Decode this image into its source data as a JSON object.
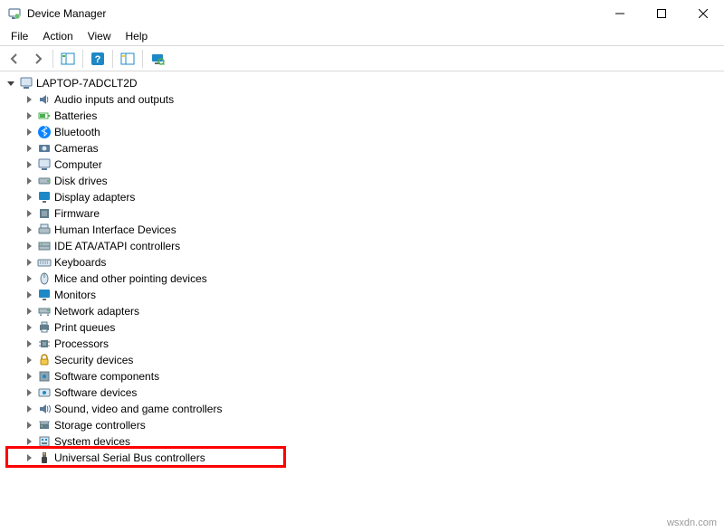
{
  "window": {
    "title": "Device Manager"
  },
  "menu": {
    "items": [
      "File",
      "Action",
      "View",
      "Help"
    ]
  },
  "tree": {
    "root": {
      "label": "LAPTOP-7ADCLT2D",
      "expanded": true
    },
    "children": [
      {
        "label": "Audio inputs and outputs",
        "icon": "audio"
      },
      {
        "label": "Batteries",
        "icon": "battery"
      },
      {
        "label": "Bluetooth",
        "icon": "bluetooth"
      },
      {
        "label": "Cameras",
        "icon": "camera"
      },
      {
        "label": "Computer",
        "icon": "computer"
      },
      {
        "label": "Disk drives",
        "icon": "disk"
      },
      {
        "label": "Display adapters",
        "icon": "display"
      },
      {
        "label": "Firmware",
        "icon": "firmware"
      },
      {
        "label": "Human Interface Devices",
        "icon": "hid"
      },
      {
        "label": "IDE ATA/ATAPI controllers",
        "icon": "ide"
      },
      {
        "label": "Keyboards",
        "icon": "keyboard"
      },
      {
        "label": "Mice and other pointing devices",
        "icon": "mouse"
      },
      {
        "label": "Monitors",
        "icon": "monitor"
      },
      {
        "label": "Network adapters",
        "icon": "network"
      },
      {
        "label": "Print queues",
        "icon": "printer"
      },
      {
        "label": "Processors",
        "icon": "cpu"
      },
      {
        "label": "Security devices",
        "icon": "security"
      },
      {
        "label": "Software components",
        "icon": "swcomp"
      },
      {
        "label": "Software devices",
        "icon": "swdev"
      },
      {
        "label": "Sound, video and game controllers",
        "icon": "sound"
      },
      {
        "label": "Storage controllers",
        "icon": "storage"
      },
      {
        "label": "System devices",
        "icon": "system"
      },
      {
        "label": "Universal Serial Bus controllers",
        "icon": "usb",
        "highlighted": true
      }
    ]
  },
  "watermark": "wsxdn.com"
}
